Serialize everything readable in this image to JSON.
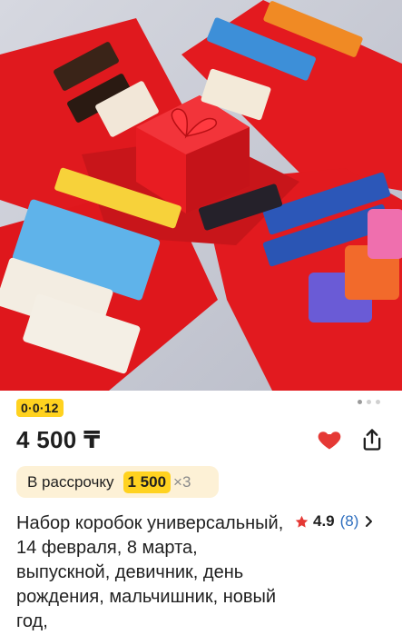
{
  "gallery": {
    "photo_alt": "",
    "counter": "0·0·12",
    "dots_total": 3,
    "dots_active": 0
  },
  "product": {
    "price": "4 500 ₸",
    "title": "Набор коробок универсальный, 14 февраля, 8 марта, выпускной, девичник, день рождения, мальчишник, новый год,"
  },
  "installment": {
    "label": "В рассрочку",
    "amount": "1 500",
    "multiplier": "×3"
  },
  "rating": {
    "score": "4.9",
    "count": "(8)"
  },
  "icons": {
    "favorite": "heart-icon",
    "share": "share-icon",
    "star": "star-icon",
    "chevron": "chevron-right-icon"
  },
  "colors": {
    "accent_yellow": "#ffd21f",
    "heart_red": "#e53935",
    "link_blue": "#2f6fbf",
    "installment_bg": "#fdf1d6"
  }
}
